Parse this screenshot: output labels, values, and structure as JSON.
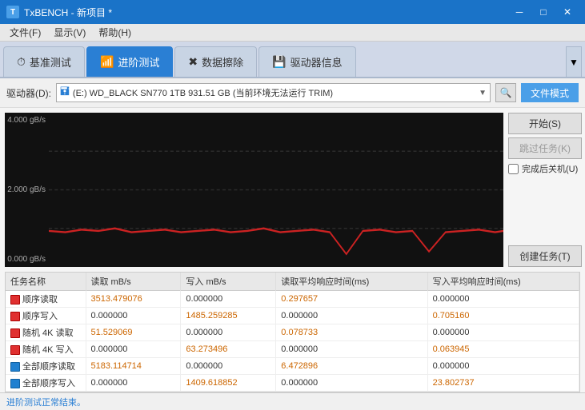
{
  "titleBar": {
    "title": "TxBENCH - 新项目 *",
    "icon": "T",
    "minBtn": "─",
    "maxBtn": "□",
    "closeBtn": "✕"
  },
  "menuBar": {
    "items": [
      "文件(F)",
      "显示(V)",
      "帮助(H)"
    ]
  },
  "tabs": [
    {
      "id": "basic",
      "label": "基准测试",
      "icon": "⏱",
      "active": false
    },
    {
      "id": "advanced",
      "label": "进阶测试",
      "icon": "📊",
      "active": true
    },
    {
      "id": "erase",
      "label": "数据擦除",
      "icon": "🗑",
      "active": false
    },
    {
      "id": "driver",
      "label": "驱动器信息",
      "icon": "💾",
      "active": false
    }
  ],
  "driveBar": {
    "label": "驱动器(D):",
    "driveText": "(E:) WD_BLACK SN770 1TB  931.51 GB (当前环境无法运行 TRIM)",
    "fileModeLabel": "文件模式"
  },
  "rightPanel": {
    "startBtn": "开始(S)",
    "skipBtn": "跳过任务(K)",
    "checkboxLabel": "完成后关机(U)",
    "createTaskBtn": "创建任务(T)"
  },
  "chart": {
    "yLabels": [
      "4.000 gB/s",
      "2.000 gB/s",
      "0.000 gB/s"
    ],
    "gridLines": [
      0.25,
      0.5,
      0.75
    ]
  },
  "table": {
    "columns": [
      "任务名称",
      "读取 mB/s",
      "写入 mB/s",
      "读取平均响应时间(ms)",
      "写入平均响应时间(ms)"
    ],
    "rows": [
      {
        "name": "顺序读取",
        "read": "3513.479076",
        "write": "0.000000",
        "readAvg": "0.297657",
        "writeAvg": "0.000000",
        "done": false
      },
      {
        "name": "顺序写入",
        "read": "0.000000",
        "write": "1485.259285",
        "readAvg": "0.000000",
        "writeAvg": "0.705160",
        "done": false
      },
      {
        "name": "随机 4K 读取",
        "read": "51.529069",
        "write": "0.000000",
        "readAvg": "0.078733",
        "writeAvg": "0.000000",
        "done": false
      },
      {
        "name": "随机 4K 写入",
        "read": "0.000000",
        "write": "63.273496",
        "readAvg": "0.000000",
        "writeAvg": "0.063945",
        "done": false
      },
      {
        "name": "全部顺序读取",
        "read": "5183.114714",
        "write": "0.000000",
        "readAvg": "6.472896",
        "writeAvg": "0.000000",
        "done": true
      },
      {
        "name": "全部顺序写入",
        "read": "0.000000",
        "write": "1409.618852",
        "readAvg": "0.000000",
        "writeAvg": "23.802737",
        "done": true
      }
    ]
  },
  "statusBar": {
    "text": "进阶测试正常结束。"
  }
}
